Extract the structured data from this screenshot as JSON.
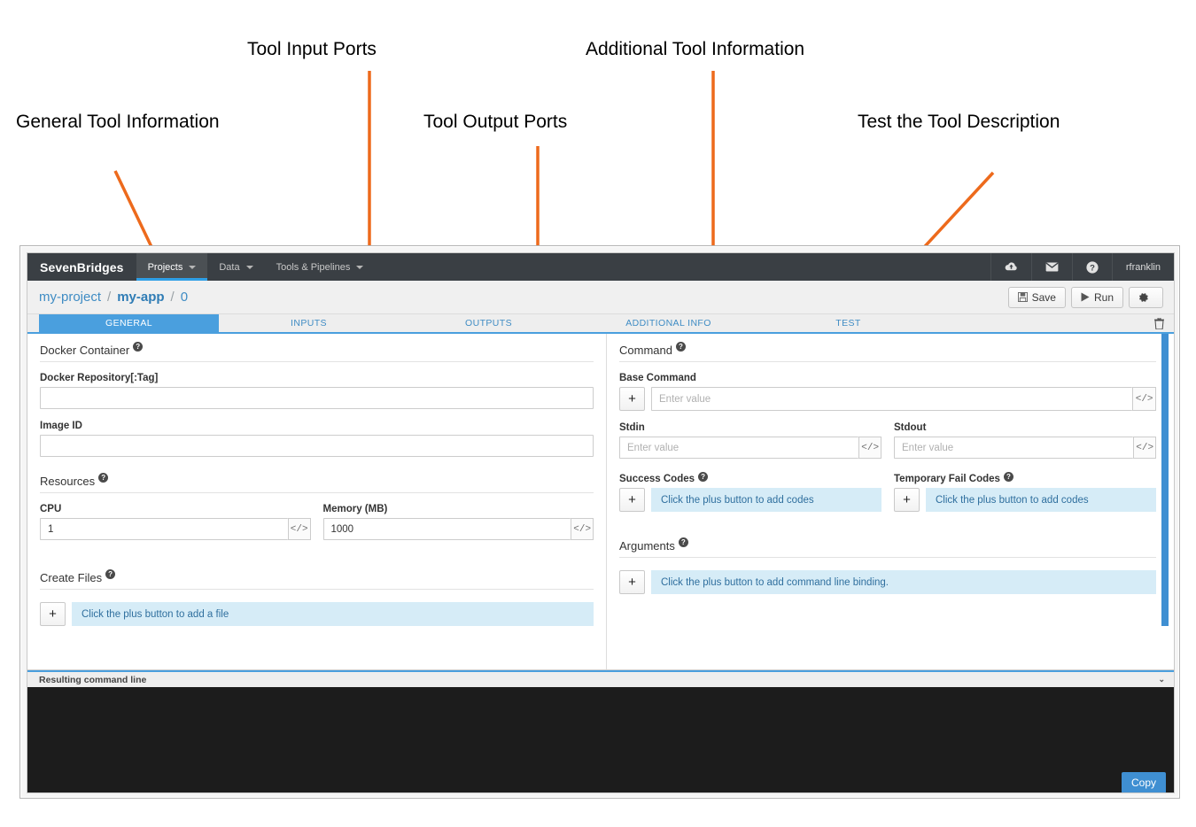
{
  "annotations": [
    {
      "id": "general",
      "label": "General Tool Information"
    },
    {
      "id": "inputs",
      "label": "Tool Input Ports"
    },
    {
      "id": "outputs",
      "label": "Tool Output Ports"
    },
    {
      "id": "addinfo",
      "label": "Additional Tool Information"
    },
    {
      "id": "test",
      "label": "Test the Tool Description"
    }
  ],
  "accent_color": "#4a9fde",
  "annotation_color": "#ED6A1C",
  "navbar": {
    "brand": "SevenBridges",
    "items": [
      {
        "label": "Projects",
        "has_caret": true,
        "active": true
      },
      {
        "label": "Data",
        "has_caret": true,
        "active": false
      },
      {
        "label": "Tools & Pipelines",
        "has_caret": true,
        "active": false
      }
    ],
    "right": [
      {
        "icon": "cloud-upload-icon",
        "has_caret": true
      },
      {
        "icon": "envelope-icon",
        "has_caret": false
      },
      {
        "icon": "help-circle-icon",
        "has_caret": true
      },
      {
        "icon": "user-menu",
        "label": "rfranklin",
        "has_caret": true
      }
    ]
  },
  "breadcrumb": {
    "project": "my-project",
    "separator": "/",
    "app": "my-app",
    "revision": "0"
  },
  "actions": {
    "save_label": "Save",
    "save_icon": "floppy-disk-icon",
    "run_label": "Run",
    "run_icon": "play-icon",
    "settings_icon": "gear-icon"
  },
  "tabs": [
    {
      "label": "GENERAL",
      "active": true
    },
    {
      "label": "INPUTS",
      "active": false
    },
    {
      "label": "OUTPUTS",
      "active": false
    },
    {
      "label": "ADDITIONAL INFO",
      "active": false
    },
    {
      "label": "TEST",
      "active": false
    }
  ],
  "trash_icon": "trash-icon",
  "left_column": {
    "docker": {
      "title": "Docker Container",
      "repository": {
        "label": "Docker Repository[:Tag]",
        "value": "",
        "placeholder": ""
      },
      "image_id": {
        "label": "Image ID",
        "value": "",
        "placeholder": ""
      }
    },
    "resources": {
      "title": "Resources",
      "cpu": {
        "label": "CPU",
        "value": "1",
        "addon": "</>"
      },
      "memory": {
        "label": "Memory (MB)",
        "value": "1000",
        "addon": "</>"
      }
    },
    "create_files": {
      "title": "Create Files",
      "plus": "+",
      "hint": "Click the plus button to add a file"
    }
  },
  "right_column": {
    "command": {
      "title": "Command",
      "base_command": {
        "label": "Base Command",
        "plus": "+",
        "placeholder": "Enter value",
        "value": "",
        "addon": "</>"
      },
      "stdin": {
        "label": "Stdin",
        "placeholder": "Enter value",
        "value": "",
        "addon": "</>"
      },
      "stdout": {
        "label": "Stdout",
        "placeholder": "Enter value",
        "value": "",
        "addon": "</>"
      },
      "success_codes": {
        "label": "Success Codes",
        "plus": "+",
        "hint": "Click the plus button to add codes"
      },
      "temporary_fail_codes": {
        "label": "Temporary Fail Codes",
        "plus": "+",
        "hint": "Click the plus button to add codes"
      }
    },
    "arguments": {
      "title": "Arguments",
      "plus": "+",
      "hint": "Click the plus button to add command line binding."
    }
  },
  "resulting_command_line": {
    "title": "Resulting command line",
    "chevron": "⌄",
    "console_text": "",
    "copy_label": "Copy"
  }
}
